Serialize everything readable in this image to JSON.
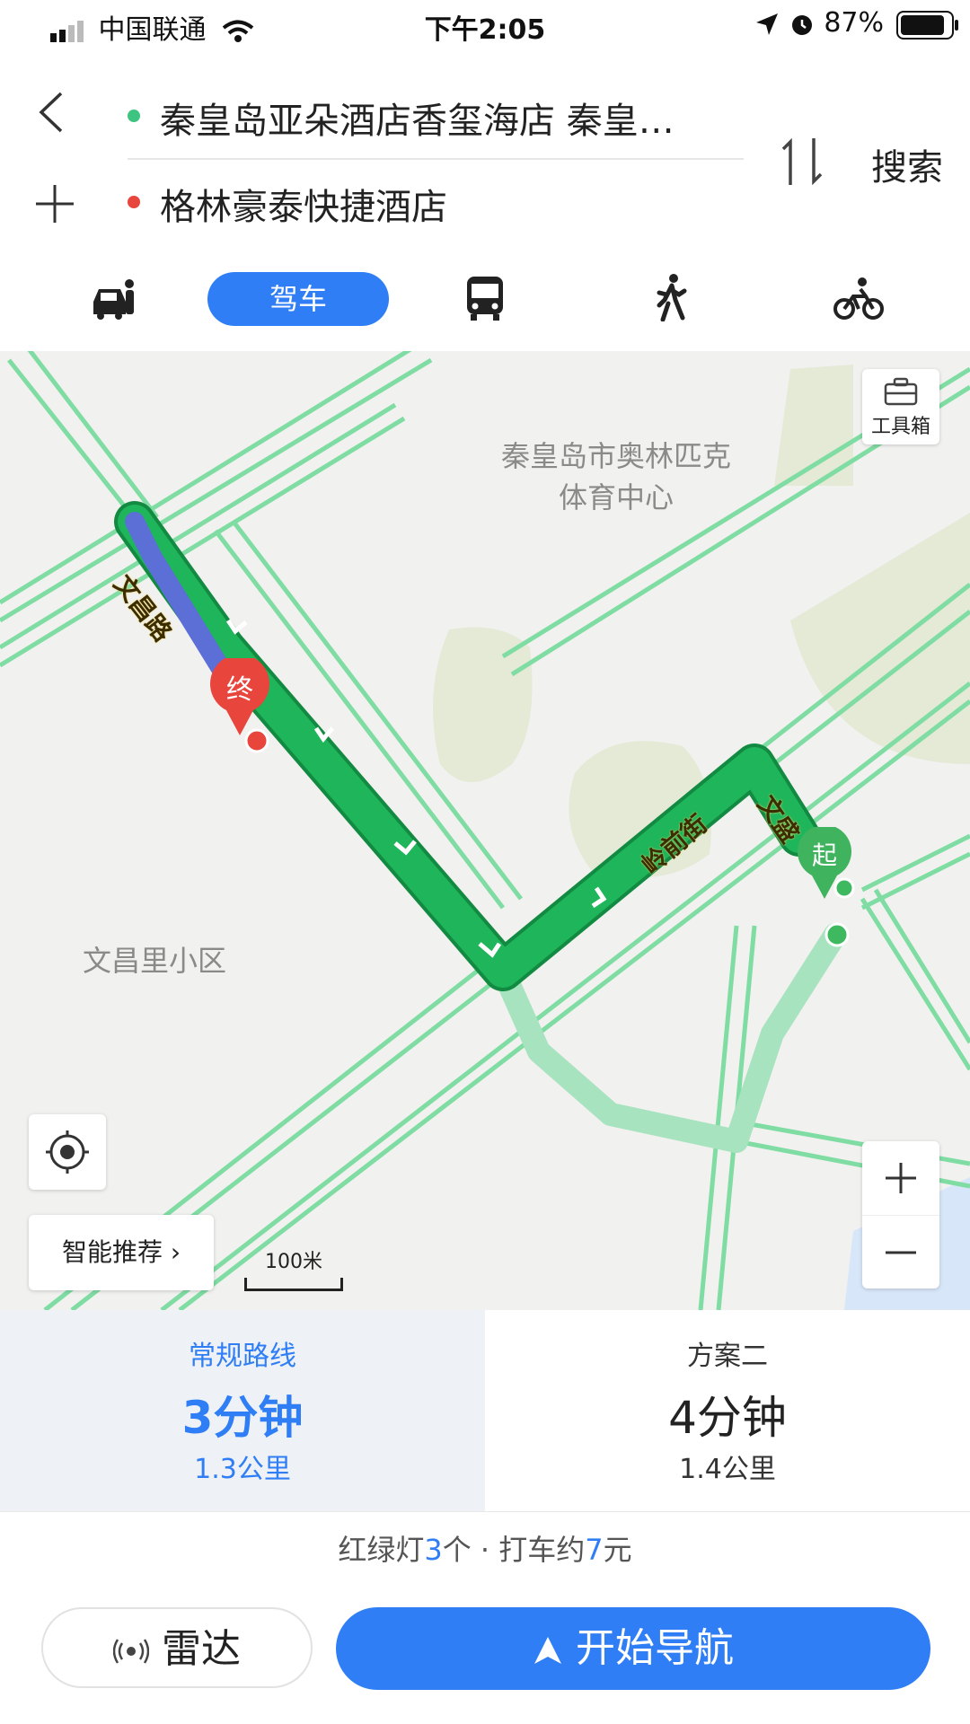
{
  "status_bar": {
    "carrier": "中国联通",
    "time": "下午2:05",
    "battery": "87%"
  },
  "route": {
    "origin": "秦皇岛亚朵酒店香玺海店 秦皇…",
    "destination": "格林豪泰快捷酒店",
    "search_label": "搜索",
    "origin_color": "#3cc480",
    "destination_color": "#e8453c"
  },
  "modes": {
    "active_label": "驾车",
    "icons": [
      "taxi-icon",
      "car-icon",
      "bus-icon",
      "walk-icon",
      "bike-icon"
    ]
  },
  "map": {
    "toolbox_label": "工具箱",
    "poi_stadium_line1": "秦皇岛市奥林匹克",
    "poi_stadium_line2": "体育中心",
    "poi_residential": "文昌里小区",
    "road_wenchang": "文昌路",
    "road_lingqian": "岭前街",
    "road_wensheng": "文盛",
    "start_marker": "起",
    "end_marker": "终",
    "smart_recommend": "智能推荐",
    "scale": "100米",
    "route_color": "#1fb55a",
    "alt_route_color": "#a8e3bf"
  },
  "plans": [
    {
      "name": "常规路线",
      "time": "3分钟",
      "distance": "1.3公里"
    },
    {
      "name": "方案二",
      "time": "4分钟",
      "distance": "1.4公里"
    }
  ],
  "trip_info": {
    "prefix": "红绿灯",
    "lights": "3",
    "mid": "个 · 打车约",
    "fare": "7",
    "suffix": "元"
  },
  "buttons": {
    "radar": "雷达",
    "navigate": "开始导航"
  },
  "accent_color": "#2f7ef5"
}
